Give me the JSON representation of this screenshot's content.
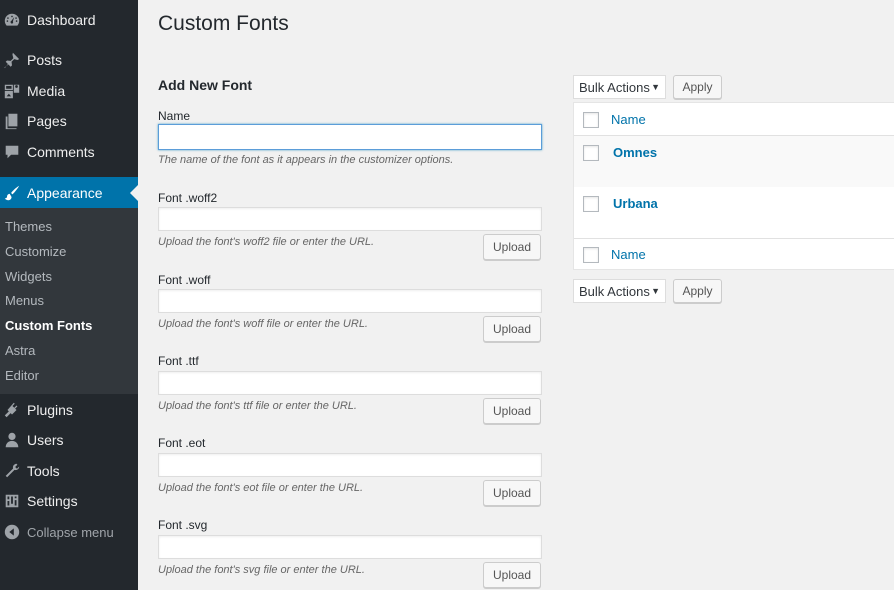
{
  "sidebar": {
    "menu": [
      {
        "label": "Dashboard",
        "icon": "dashboard-icon"
      },
      {
        "label": "Posts",
        "icon": "pushpin-icon"
      },
      {
        "label": "Media",
        "icon": "media-icon"
      },
      {
        "label": "Pages",
        "icon": "pages-icon"
      },
      {
        "label": "Comments",
        "icon": "comment-icon"
      },
      {
        "label": "Appearance",
        "icon": "paintbrush-icon"
      }
    ],
    "submenu": [
      "Themes",
      "Customize",
      "Widgets",
      "Menus",
      "Custom Fonts",
      "Astra",
      "Editor"
    ],
    "menu_lower": [
      {
        "label": "Plugins",
        "icon": "plugin-icon"
      },
      {
        "label": "Users",
        "icon": "user-icon"
      },
      {
        "label": "Tools",
        "icon": "wrench-icon"
      },
      {
        "label": "Settings",
        "icon": "settings-icon"
      }
    ],
    "collapse_label": "Collapse menu"
  },
  "page": {
    "title": "Custom Fonts"
  },
  "form": {
    "heading": "Add New Font",
    "name_label": "Name",
    "name_value": "",
    "name_desc": "The name of the font as it appears in the customizer options.",
    "upload_label": "Upload",
    "fields": [
      {
        "label": "Font .woff2",
        "value": "",
        "desc": "Upload the font's woff2 file or enter the URL."
      },
      {
        "label": "Font .woff",
        "value": "",
        "desc": "Upload the font's woff file or enter the URL."
      },
      {
        "label": "Font .ttf",
        "value": "",
        "desc": "Upload the font's ttf file or enter the URL."
      },
      {
        "label": "Font .eot",
        "value": "",
        "desc": "Upload the font's eot file or enter the URL."
      },
      {
        "label": "Font .svg",
        "value": "",
        "desc": "Upload the font's svg file or enter the URL."
      }
    ]
  },
  "list": {
    "bulk_actions": "Bulk Actions",
    "apply_label": "Apply",
    "column_name": "Name",
    "rows": [
      "Omnes",
      "Urbana"
    ]
  },
  "colors": {
    "sidebar_bg": "#23282d",
    "submenu_bg": "#32373c",
    "accent": "#0073aa",
    "page_bg": "#f1f1f1",
    "link": "#0073aa"
  }
}
